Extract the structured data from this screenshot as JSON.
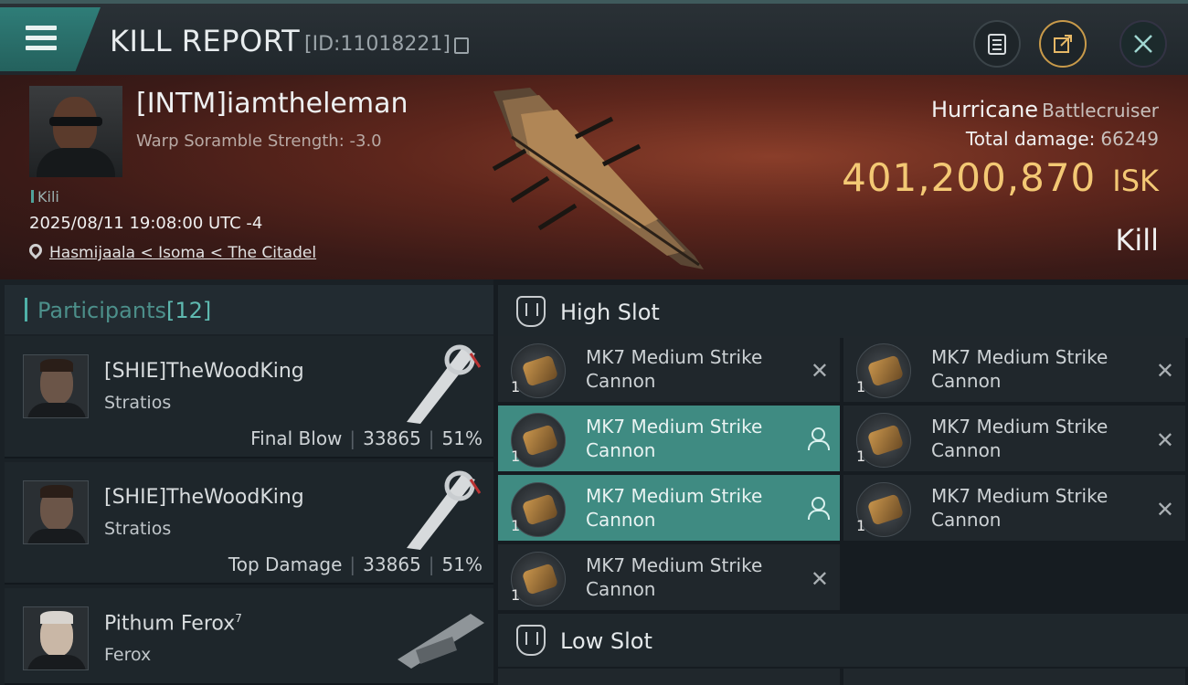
{
  "header": {
    "title": "KILL REPORT",
    "report_id": "[ID:11018221]",
    "icons": [
      "menu-icon",
      "copy-icon",
      "clipboard-icon",
      "share-icon",
      "close-icon"
    ]
  },
  "victim": {
    "pilot": "[INTM]iamtheleman",
    "scramble": "Warp Soramble Strength: -3.0",
    "kill_tag": "Kili",
    "datetime": "2025/08/11 19:08:00 UTC -4",
    "location": "Hasmijaala < Isoma < The Citadel",
    "ship": "Hurricane",
    "ship_class": "Battlecruiser",
    "total_damage_label": "Total damage:",
    "total_damage": "66249",
    "isk_value": "401,200,870",
    "isk_unit": "ISK",
    "result": "Kill"
  },
  "participants": {
    "label": "Participants",
    "count": "[12]",
    "items": [
      {
        "name": "[SHIE]TheWoodKing",
        "ship": "Stratios",
        "tag": "Final Blow",
        "damage": "33865",
        "percent": "51%"
      },
      {
        "name": "[SHIE]TheWoodKing",
        "ship": "Stratios",
        "tag": "Top Damage",
        "damage": "33865",
        "percent": "51%"
      },
      {
        "name": "Pithum Ferox",
        "sup": "7",
        "ship": "Ferox",
        "tag": "",
        "damage": "",
        "percent": ""
      }
    ]
  },
  "slots": {
    "high": {
      "label": "High Slot",
      "modules": [
        {
          "line1": "MK7 Medium Strike",
          "line2": "Cannon",
          "qty": "1",
          "state": "destroyed"
        },
        {
          "line1": "MK7 Medium Strike",
          "line2": "Cannon",
          "qty": "1",
          "state": "destroyed"
        },
        {
          "line1": "MK7 Medium Strike",
          "line2": "Cannon",
          "qty": "1",
          "state": "dropped"
        },
        {
          "line1": "MK7 Medium Strike",
          "line2": "Cannon",
          "qty": "1",
          "state": "destroyed"
        },
        {
          "line1": "MK7 Medium Strike",
          "line2": "Cannon",
          "qty": "1",
          "state": "dropped"
        },
        {
          "line1": "MK7 Medium Strike",
          "line2": "Cannon",
          "qty": "1",
          "state": "destroyed"
        },
        {
          "line1": "MK7 Medium Strike",
          "line2": "Cannon",
          "qty": "1",
          "state": "destroyed"
        }
      ]
    },
    "low": {
      "label": "Low Slot"
    }
  },
  "colors": {
    "accent_teal": "#3f8b82",
    "isk_gold": "#f3c874",
    "banner_red": "#5e261c"
  }
}
